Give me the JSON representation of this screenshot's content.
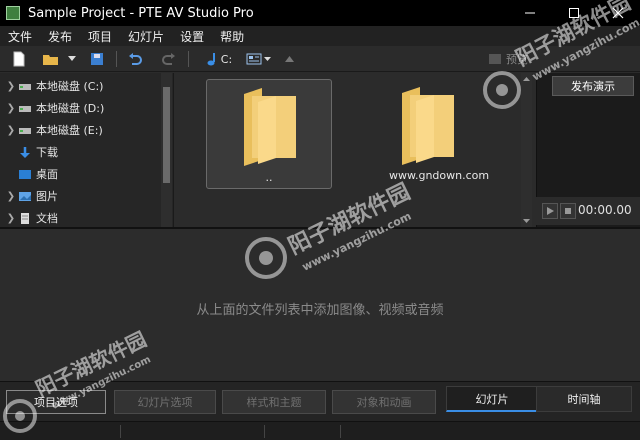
{
  "window": {
    "title": "Sample Project - PTE AV Studio Pro",
    "minimize_icon": "minimize-icon",
    "maximize_icon": "maximize-icon",
    "close_icon": "close-icon"
  },
  "menu": {
    "items": [
      "文件",
      "发布",
      "项目",
      "幻灯片",
      "设置",
      "帮助"
    ]
  },
  "toolbar": {
    "drive_label": "C:",
    "preview_label": "预览",
    "icons": [
      "new-project-icon",
      "open-project-icon",
      "save-icon",
      "undo-icon",
      "redo-icon",
      "music-note-icon",
      "view-mode-icon",
      "up-arrow-icon"
    ]
  },
  "folder_tree": {
    "items": [
      {
        "label": "本地磁盘 (C:)",
        "icon": "drive-icon"
      },
      {
        "label": "本地磁盘 (D:)",
        "icon": "drive-icon"
      },
      {
        "label": "本地磁盘 (E:)",
        "icon": "drive-icon"
      },
      {
        "label": "下载",
        "icon": "download-icon"
      },
      {
        "label": "桌面",
        "icon": "desktop-icon"
      },
      {
        "label": "图片",
        "icon": "pictures-icon"
      },
      {
        "label": "文档",
        "icon": "documents-icon"
      }
    ]
  },
  "files": {
    "items": [
      {
        "label": "..",
        "icon": "folder-icon"
      },
      {
        "label": "",
        "icon": "folder-icon"
      }
    ]
  },
  "preview": {
    "present_button": "发布演示",
    "time": "00:00.00"
  },
  "slides": {
    "empty_hint": "从上面的文件列表中添加图像、视频或音频"
  },
  "bottom": {
    "buttons": [
      "项目选项",
      "幻灯片选项",
      "样式和主题",
      "对象和动画"
    ],
    "tabs": [
      "幻灯片",
      "时间轴"
    ]
  },
  "watermark": {
    "site_name": "阳子湖软件园",
    "site_url": "www.yangzihu.com",
    "gndown_url": "www.gndown.com"
  },
  "colors": {
    "accent": "#3a8ee6",
    "folder": "#f3cf7a"
  }
}
